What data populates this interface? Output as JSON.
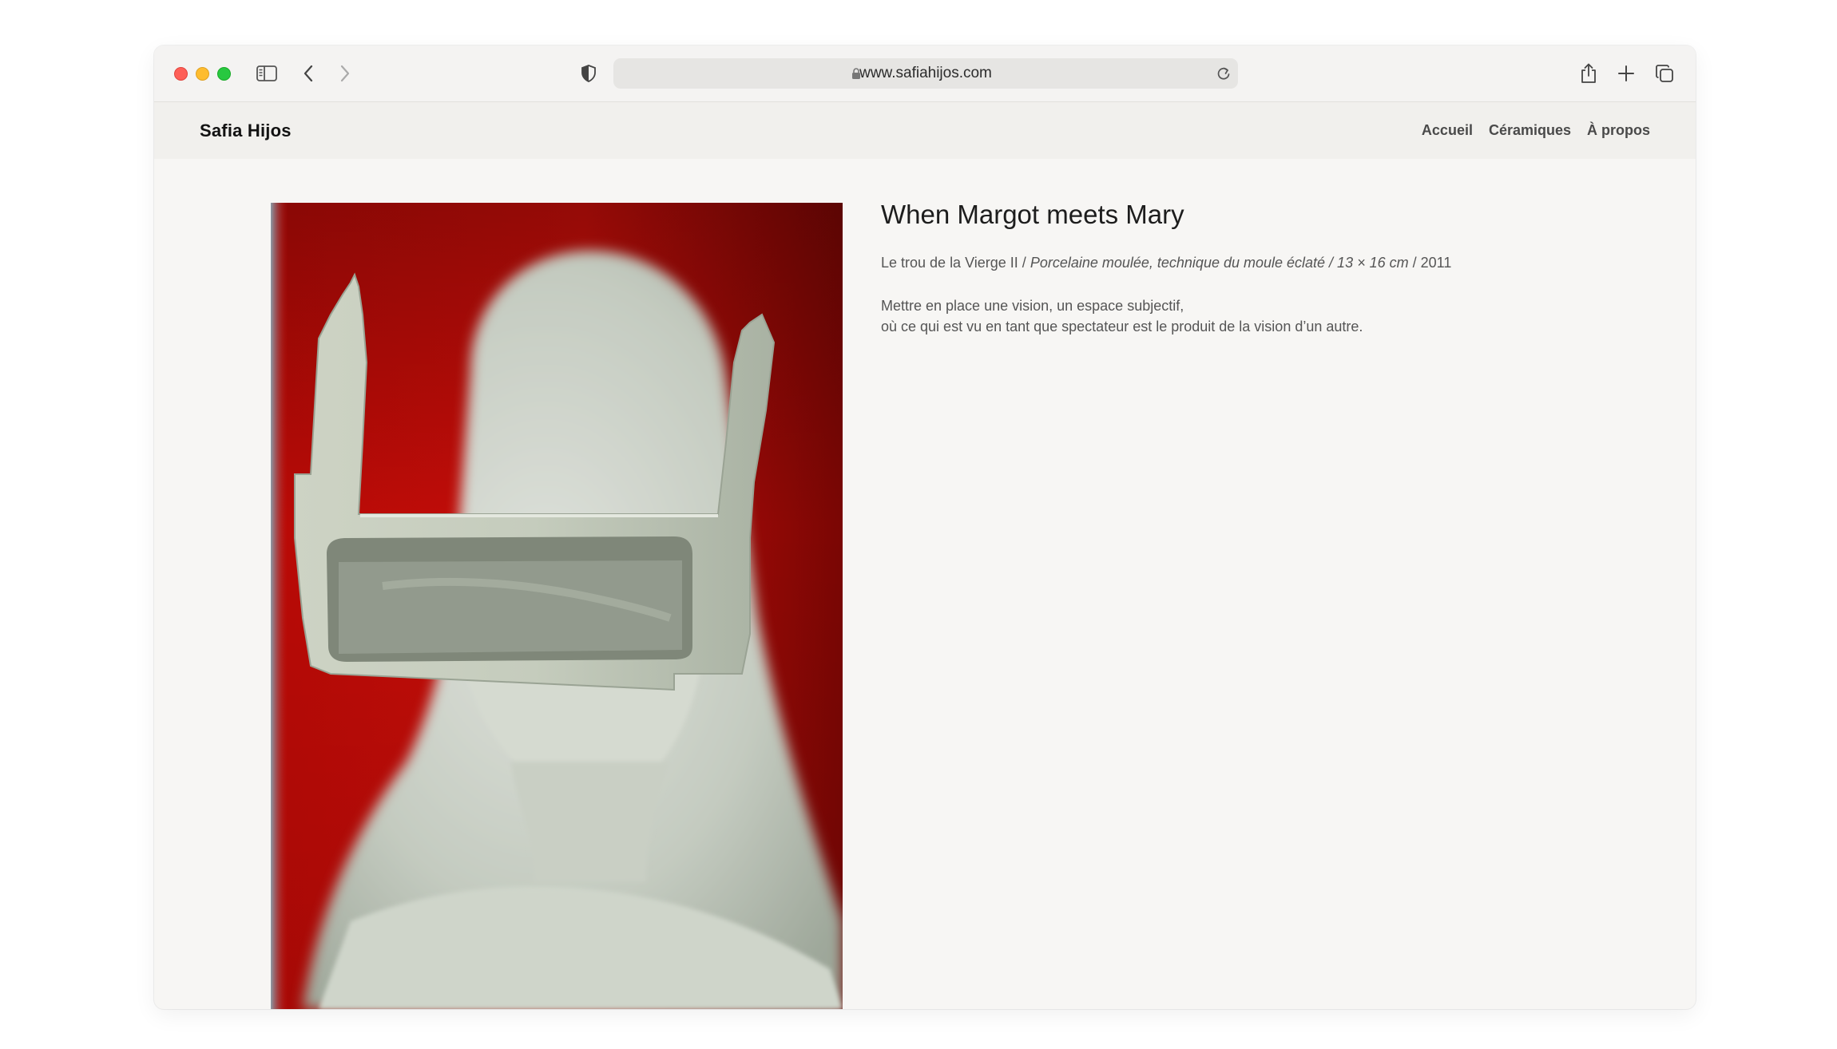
{
  "browser": {
    "url": "www.safiahijos.com",
    "icons": {
      "sidebar": "sidebar-icon",
      "back": "chevron-left-icon",
      "forward": "chevron-right-icon",
      "privacy": "shield-icon",
      "lock": "lock-icon",
      "reload": "reload-icon",
      "share": "share-icon",
      "new_tab": "plus-icon",
      "tabs": "tab-overview-icon"
    }
  },
  "site": {
    "brand": "Safia Hijos",
    "nav": [
      {
        "label": "Accueil"
      },
      {
        "label": "Céramiques"
      },
      {
        "label": "À propos"
      }
    ]
  },
  "artwork": {
    "title": "When Margot meets Mary",
    "name": "Le trou de la Vierge II",
    "separator": " / ",
    "medium": "Porcelaine moulée, technique du moule éclaté / 13 × 16 cm",
    "year": "2011",
    "description": [
      "Mettre en place une vision, un espace subjectif,",
      "où ce qui est vu en tant que spectateur est le produit de la vision d’un autre."
    ]
  },
  "colors": {
    "background": "#f7f6f4",
    "header": "#f1f0ed",
    "artwork_red": "#c40c08",
    "porcelain": "#c9cfc0"
  }
}
